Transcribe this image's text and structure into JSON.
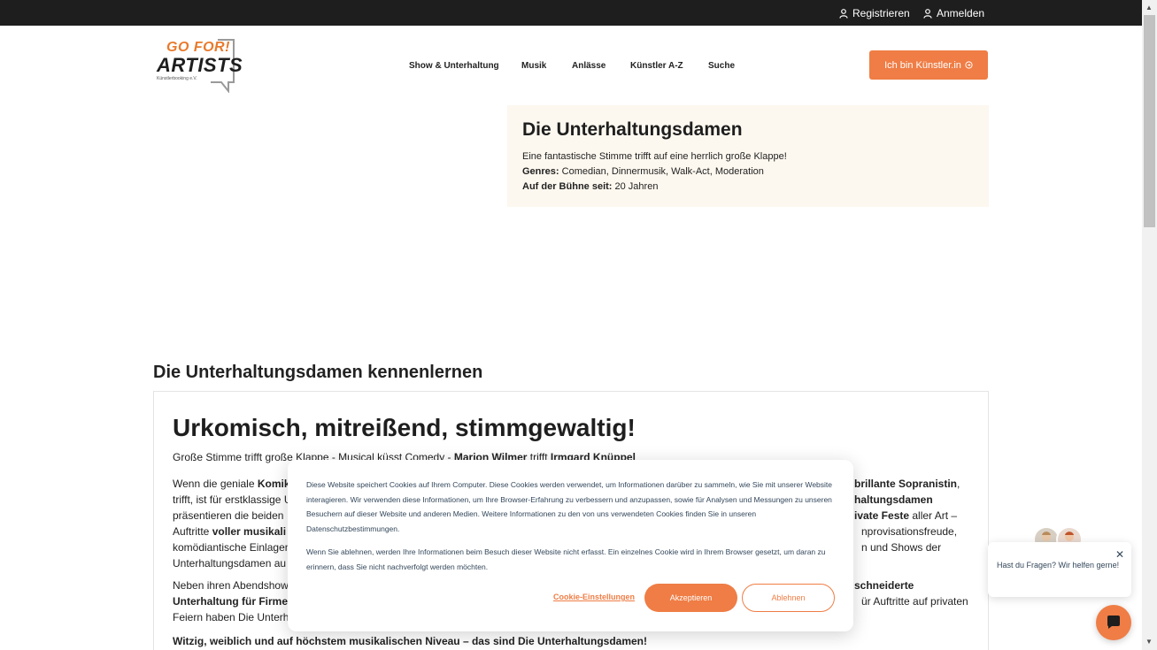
{
  "topbar": {
    "register": "Registrieren",
    "login": "Anmelden"
  },
  "logo": {
    "line1": "GO FOR!",
    "line2": "ARTISTS",
    "tagline": "Künstlerbooking e.V."
  },
  "nav": {
    "items": [
      {
        "label": "Show & Unterhaltung"
      },
      {
        "label": "Musik"
      },
      {
        "label": "Anlässe"
      },
      {
        "label": "Künstler A-Z"
      },
      {
        "label": "Suche"
      }
    ]
  },
  "cta": {
    "label": "Ich bin Künstler.in"
  },
  "artist": {
    "name": "Die Unterhaltungsdamen",
    "tagline": "Eine fantastische Stimme trifft auf eine herrlich große Klappe!",
    "genres_label": "Genres:",
    "genres": "Comedian, Dinnermusik, Walk-Act, Moderation",
    "stage_label": "Auf der Bühne seit:",
    "stage_value": "20 Jahren"
  },
  "about": {
    "section_title": "Die Unterhaltungsdamen kennenlernen",
    "headline": "Urkomisch, mitreißend, stimmgewaltig!",
    "lead_1": "Große Stimme trifft große Klappe - Musical küsst Comedy - ",
    "lead_name_1": "Marion Wilmer",
    "lead_2": " trifft ",
    "lead_name_2": "Irmgard Knüppel",
    "p1_l1_a": "Wenn die geniale ",
    "p1_l1_b": "Komik",
    "p1_l1_c": "brillante Sopranistin",
    "p1_l1_d": ",",
    "p1_l2_a": "trifft, ist für erstklassige U",
    "p1_l2_b": "haltungsdamen",
    "p1_l3_a": "präsentieren die beiden",
    "p1_l3_b": "ivate Feste",
    "p1_l3_c": " aller Art –",
    "p1_l4_a": "Auftritte ",
    "p1_l4_b": "voller musikali",
    "p1_l4_c": "nprovisationsfreude,",
    "p1_l5_a": "komödiantische Einlagen",
    "p1_l5_b": "n und Shows der",
    "p1_l6_a": "Unterhaltungsdamen au",
    "p2_l1_a": "Neben ihren Abendshow",
    "p2_l1_b": "schneiderte",
    "p2_l2_a": "Unterhaltung für Firme",
    "p2_l2_b": "ür Auftritte auf privaten",
    "p2_l3_a": "Feiern haben Die Unterh",
    "closing": "Witzig, weiblich und auf höchstem musikalischen Niveau – das sind Die Unterhaltungsdamen!"
  },
  "cookie": {
    "text1": "Diese Website speichert Cookies auf Ihrem Computer. Diese Cookies werden verwendet, um Informationen darüber zu sammeln, wie Sie mit unserer Website interagieren. Wir verwenden diese Informationen, um Ihre Browser-Erfahrung zu verbessern und anzupassen, sowie für Analysen und Messungen zu unseren Besuchern auf dieser Website und anderen Medien. Weitere Informationen zu den von uns verwendeten Cookies finden Sie in unseren Datenschutzbestimmungen.",
    "text2": "Wenn Sie ablehnen, werden Ihre Informationen beim Besuch dieser Website nicht erfasst. Ein einzelnes Cookie wird in Ihrem Browser gesetzt, um daran zu erinnern, dass Sie nicht nachverfolgt werden möchten.",
    "settings": "Cookie-Einstellungen",
    "accept": "Akzeptieren",
    "decline": "Ablehnen"
  },
  "chat": {
    "message": "Hast du Fragen? Wir helfen gerne!"
  },
  "colors": {
    "accent": "#ef7d45",
    "topbar": "#1e1e1e",
    "infobox_bg": "#fdf8ef"
  }
}
